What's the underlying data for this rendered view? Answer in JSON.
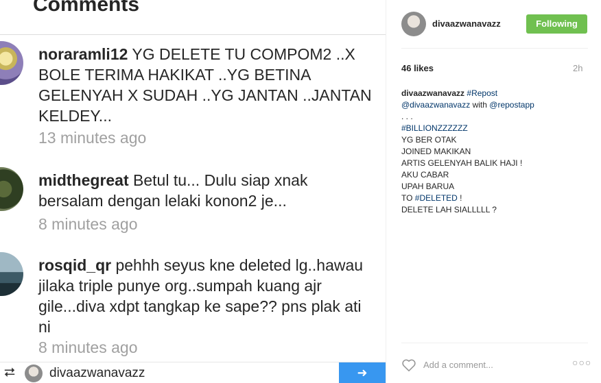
{
  "left": {
    "title": "Comments",
    "comments": [
      {
        "username": "noraramli12",
        "text": "YG DELETE TU COMPOM2 ..X BOLE TERIMA HAKIKAT ..YG BETINA GELENYAH X SUDAH ..YG JANTAN ..JANTAN KELDEY...",
        "time": "13 minutes ago"
      },
      {
        "username": "midthegreat",
        "text": "Betul tu... Dulu siap xnak bersalam dengan lelaki konon2 je...",
        "time": "8 minutes ago"
      },
      {
        "username": "rosqid_qr",
        "text": "pehhh seyus kne deleted lg..hawau jilaka triple punye org..sumpah kuang ajr gile...diva xdpt tangkap ke sape?? pns plak ati ni",
        "time": "8 minutes ago"
      }
    ],
    "repost_bar": {
      "icon": "repost-icon",
      "username": "divaazwanavazz",
      "button_icon": "arrow-icon"
    }
  },
  "right": {
    "username": "divaazwanavazz",
    "follow_label": "Following",
    "likes": "46 likes",
    "age": "2h",
    "caption": {
      "username": "divaazwanavazz",
      "hashtag_repost": "#Repost",
      "mention": "@divaazwanavazz",
      "with_text": "with",
      "app_mention": "@repostapp",
      "dots": ". . .",
      "hashtag_billion": "#BILLIONZZZZZZ",
      "line1": "YG BER OTAK",
      "line2": "JOINED MAKIKAN",
      "line3": "ARTIS GELENYAH BALIK HAJI !",
      "line4": "AKU CABAR",
      "line5": "UPAH BARUA",
      "to_text": "TO",
      "hashtag_deleted": "#DELETED",
      "to_suffix": "!",
      "line7": "DELETE LAH SIALLLLL ?"
    },
    "add_comment_placeholder": "Add a comment...",
    "icons": {
      "like": "heart-icon",
      "more": "more-options-icon"
    },
    "colors": {
      "follow_button": "#70c050",
      "link": "#003569",
      "repost_button": "#3897f0"
    }
  }
}
